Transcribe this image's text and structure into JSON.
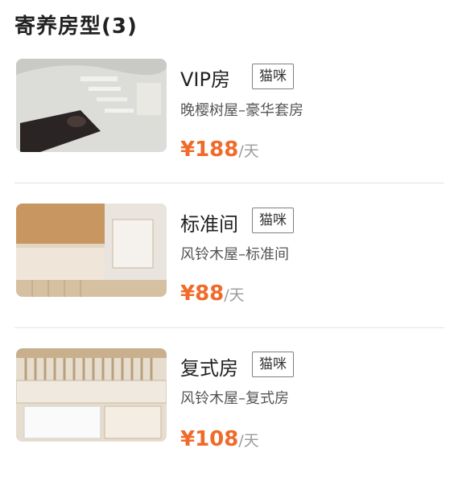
{
  "section": {
    "title": "寄养房型(3)"
  },
  "rooms": [
    {
      "name": "VIP房",
      "tag": "猫咪",
      "subtitle": "晚樱树屋–豪华套房",
      "price": "¥188",
      "unit": "/天",
      "thumb_label": ""
    },
    {
      "name": "标准间",
      "tag": "猫咪",
      "subtitle": "风铃木屋–标准间",
      "price": "¥88",
      "unit": "/天",
      "thumb_label": ""
    },
    {
      "name": "复式房",
      "tag": "猫咪",
      "subtitle": "风铃木屋–复式房",
      "price": "¥108",
      "unit": "/天",
      "thumb_label": ""
    }
  ],
  "colors": {
    "price": "#f06a2a",
    "divider": "#e2e2e2",
    "tag_border": "#7f7f7f"
  }
}
